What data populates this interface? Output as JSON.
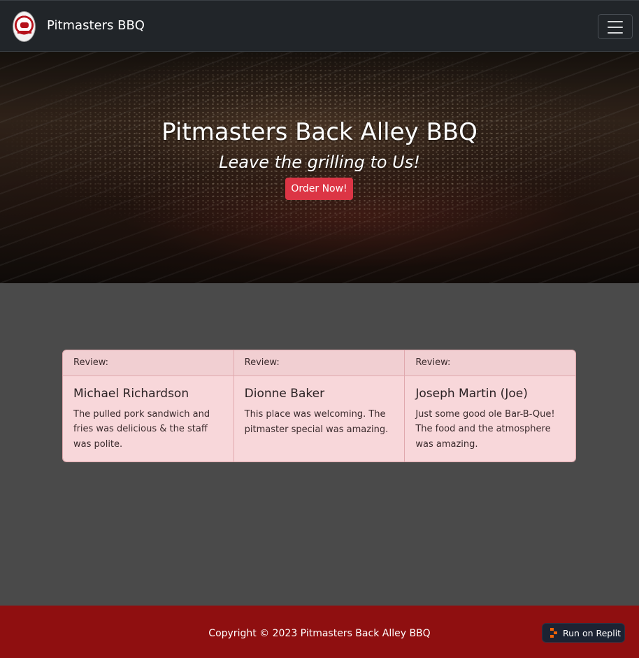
{
  "navbar": {
    "brand": "Pitmasters BBQ",
    "logo_icon": "pitmasters-logo",
    "toggle_icon": "hamburger-icon"
  },
  "hero": {
    "title": "Pitmasters Back Alley BBQ",
    "subtitle": "Leave the grilling to Us!",
    "cta_label": "Order Now!"
  },
  "reviews": [
    {
      "header": "Review:",
      "name": "Michael Richardson",
      "text": "The pulled pork sandwich and fries was delicious & the staff was polite."
    },
    {
      "header": "Review:",
      "name": "Dionne Baker",
      "text": "This place was welcoming. The pitmaster special was amazing."
    },
    {
      "header": "Review:",
      "name": "Joseph Martin (Joe)",
      "text": "Just some good ole Bar-B-Que! The food and the atmosphere was amazing."
    }
  ],
  "footer": {
    "copyright": "Copyright © 2023 Pitmasters Back Alley BBQ",
    "replit_label": "Run on Replit",
    "replit_icon": "replit-icon"
  },
  "colors": {
    "navbar": "#212529",
    "accent_button": "#dc3545",
    "card_bg": "#f8d7da",
    "page_bg": "#4a4a4a",
    "footer_bg": "#8f0f10"
  }
}
